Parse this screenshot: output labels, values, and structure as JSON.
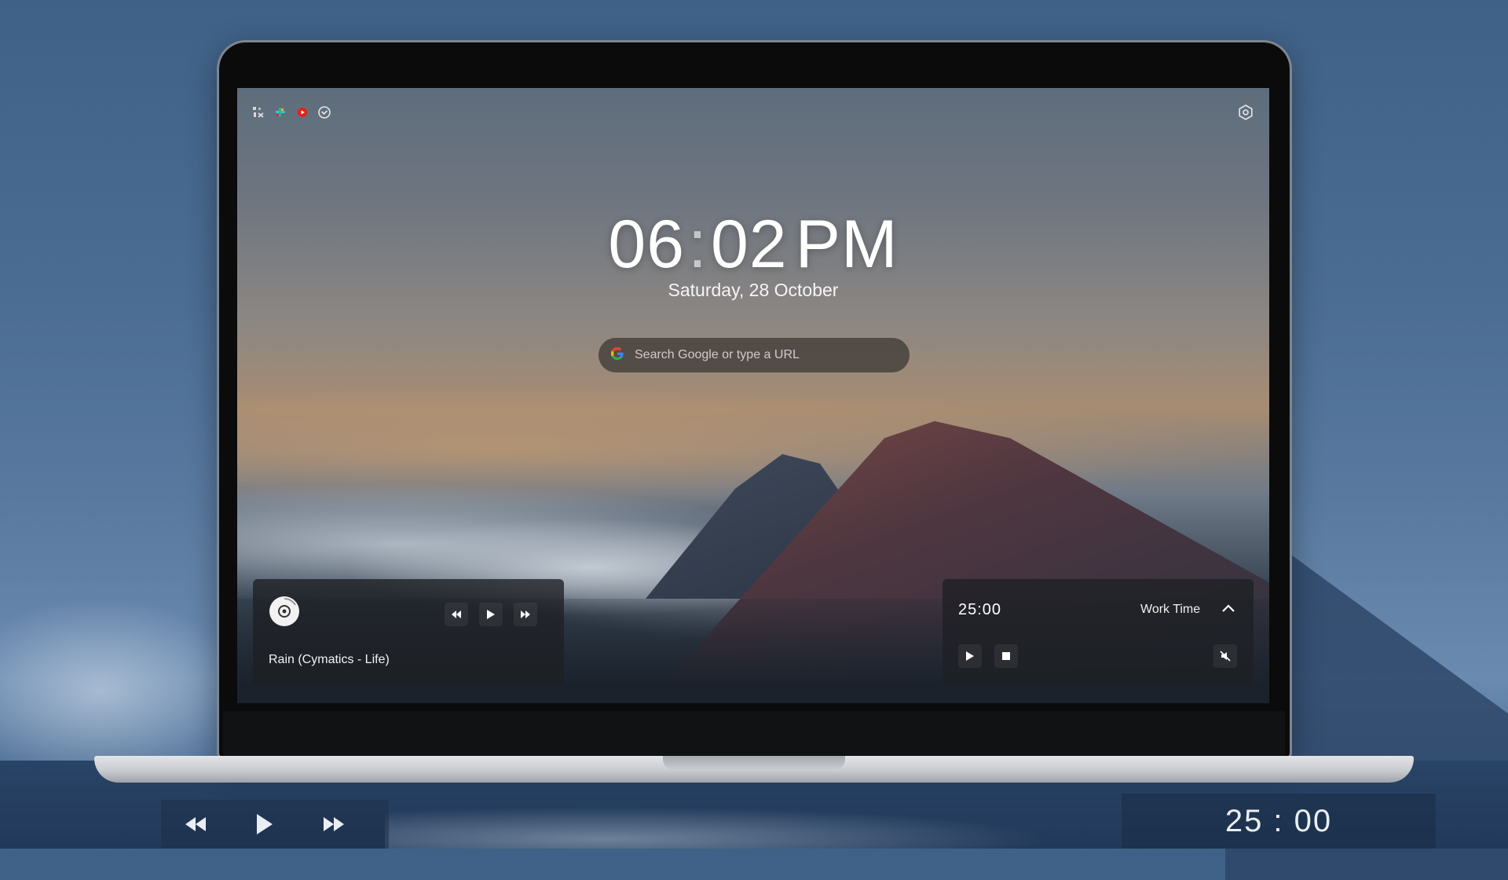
{
  "newtab": {
    "clock": {
      "hours": "06",
      "separator": ":",
      "minutes": "02",
      "ampm": "PM"
    },
    "date": "Saturday, 28 October",
    "search": {
      "placeholder": "Search Google or type a URL"
    },
    "quick_icons": [
      "grid-icon",
      "slack-icon",
      "youtube-icon",
      "check-circle-icon"
    ],
    "settings_icon": "gear-icon"
  },
  "music_player": {
    "track": "Rain (Cymatics - Life)",
    "controls": [
      "rewind-icon",
      "play-icon",
      "fast-forward-icon"
    ]
  },
  "pomodoro": {
    "time": "25:00",
    "mode": "Work Time",
    "controls": [
      "play-icon",
      "stop-icon",
      "mute-icon"
    ]
  },
  "overlay": {
    "controls": [
      "rewind-icon",
      "play-icon",
      "fast-forward-icon"
    ],
    "timer": "25 : 00"
  },
  "colors": {
    "panel_bg": "#1e2024",
    "text": "#ffffff",
    "background": "#4b6c93",
    "youtube_red": "#e62117"
  }
}
